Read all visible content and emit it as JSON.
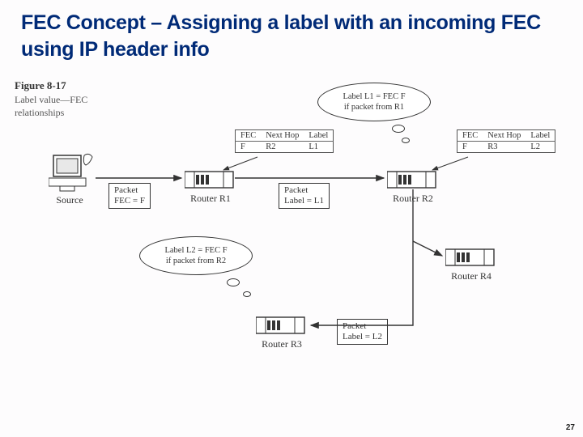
{
  "title": "FEC Concept – Assigning a label with an incoming FEC using IP header info",
  "figure": {
    "num": "Figure 8-17",
    "caption": "Label value—FEC relationships"
  },
  "nodes": {
    "source": "Source",
    "r1": "Router R1",
    "r2": "Router R2",
    "r3": "Router R3",
    "r4": "Router R4"
  },
  "tableHeaders": {
    "fec": "FEC",
    "nextHop": "Next Hop",
    "label": "Label"
  },
  "tableR1": {
    "fec": "F",
    "nextHop": "R2",
    "label": "L1"
  },
  "tableR2": {
    "fec": "F",
    "nextHop": "R3",
    "label": "L2"
  },
  "packets": {
    "p1_l1": "Packet",
    "p1_l2": "FEC = F",
    "p2_l1": "Packet",
    "p2_l2": "Label = L1",
    "p3_l1": "Packet",
    "p3_l2": "Label = L2"
  },
  "bubbles": {
    "b1_l1": "Label L1 = FEC F",
    "b1_l2": "if packet from R1",
    "b2_l1": "Label L2 = FEC F",
    "b2_l2": "if packet from R2"
  },
  "pageNumber": "27"
}
